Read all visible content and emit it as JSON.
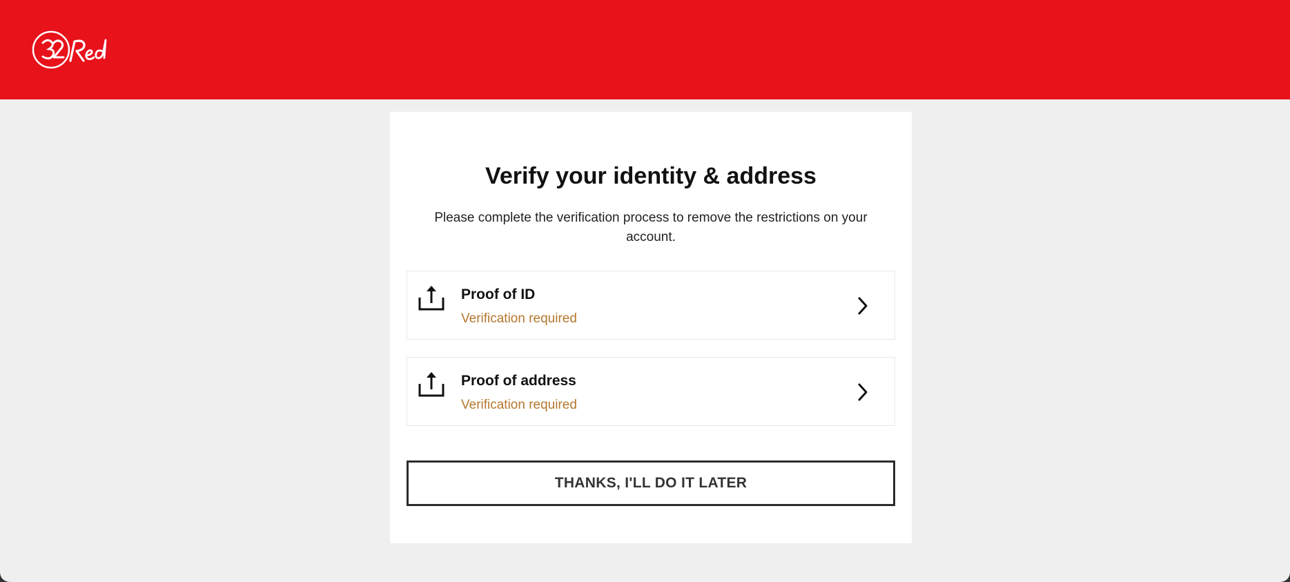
{
  "header": {
    "brand_logo_text": "32Red",
    "background_color": "#e8121b"
  },
  "verification": {
    "title": "Verify your identity & address",
    "description": "Please complete the verification process to remove the restrictions on your account.",
    "items": [
      {
        "label": "Proof of ID",
        "status": "Verification required",
        "icon": "upload-icon"
      },
      {
        "label": "Proof of address",
        "status": "Verification required",
        "icon": "upload-icon"
      }
    ],
    "later_button_label": "THANKS, I'LL DO IT LATER",
    "status_color": "#b5772d"
  }
}
